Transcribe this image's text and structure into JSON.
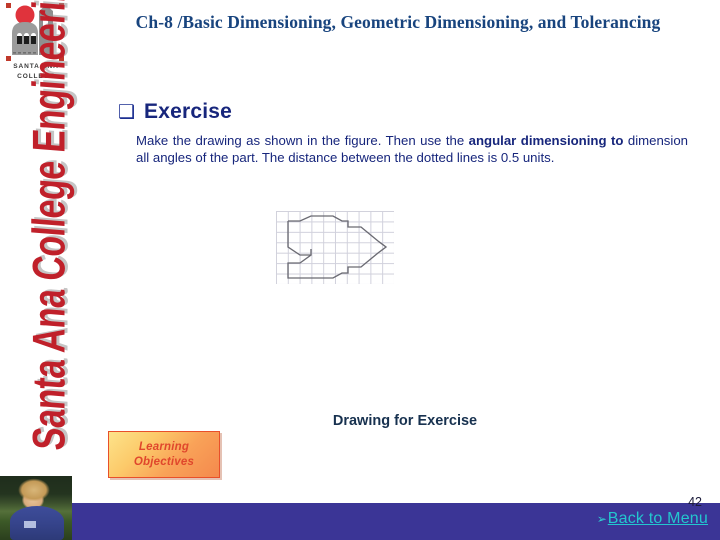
{
  "slide": {
    "header_title": "Ch-8 /Basic Dimensioning, Geometric Dimensioning, and Tolerancing",
    "page_number": "42"
  },
  "branding": {
    "logo_icon": "santa-ana-college-building-logo",
    "logo_name_line1": "SANTA ANA",
    "logo_name_line2": "COLLEGE",
    "vertical_title": "Santa Ana College Engineering",
    "photo_alt": "student-photo"
  },
  "content": {
    "bullet_glyph": "❑",
    "bullet_label": "Exercise",
    "paragraph": {
      "segment_1": "Make the drawing as shown in the   figure. Then use the ",
      "bold_1": "angular dimensioning to",
      "segment_2": " dimension all angles of the part. The distance between the dotted lines is 0.5 units."
    }
  },
  "figure": {
    "caption": "Drawing for Exercise",
    "grid_label": "dotted-grid-0.5-units",
    "shape_label": "angular-part-outline"
  },
  "navigation": {
    "learning_objectives_line1": "Learning",
    "learning_objectives_line2": "Objectives",
    "back_arrow_glyph": "➢",
    "back_to_menu_label": "Back to Menu"
  },
  "colors": {
    "title_blue": "#18447e",
    "body_navy": "#17267c",
    "brand_red": "#c0202a",
    "footer_bar": "#3b3596",
    "link_cyan": "#23c7cf",
    "button_border": "#e8502a"
  }
}
